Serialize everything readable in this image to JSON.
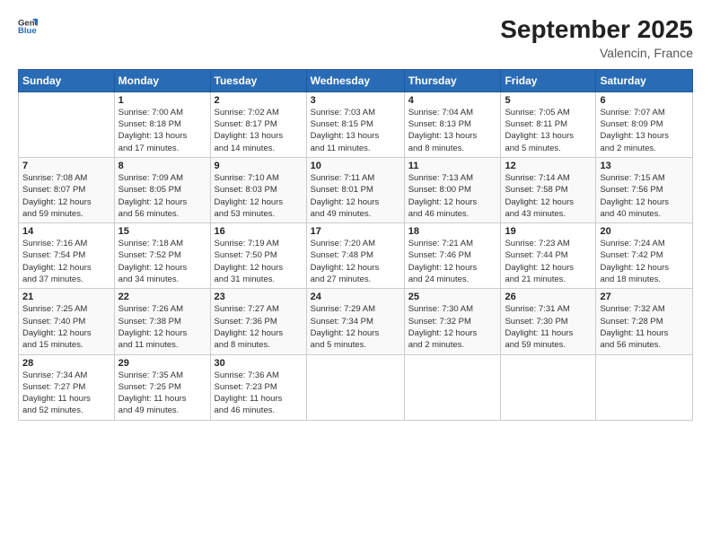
{
  "logo": {
    "general": "General",
    "blue": "Blue"
  },
  "title": "September 2025",
  "subtitle": "Valencin, France",
  "days_header": [
    "Sunday",
    "Monday",
    "Tuesday",
    "Wednesday",
    "Thursday",
    "Friday",
    "Saturday"
  ],
  "weeks": [
    [
      {
        "num": "",
        "info": ""
      },
      {
        "num": "1",
        "info": "Sunrise: 7:00 AM\nSunset: 8:18 PM\nDaylight: 13 hours\nand 17 minutes."
      },
      {
        "num": "2",
        "info": "Sunrise: 7:02 AM\nSunset: 8:17 PM\nDaylight: 13 hours\nand 14 minutes."
      },
      {
        "num": "3",
        "info": "Sunrise: 7:03 AM\nSunset: 8:15 PM\nDaylight: 13 hours\nand 11 minutes."
      },
      {
        "num": "4",
        "info": "Sunrise: 7:04 AM\nSunset: 8:13 PM\nDaylight: 13 hours\nand 8 minutes."
      },
      {
        "num": "5",
        "info": "Sunrise: 7:05 AM\nSunset: 8:11 PM\nDaylight: 13 hours\nand 5 minutes."
      },
      {
        "num": "6",
        "info": "Sunrise: 7:07 AM\nSunset: 8:09 PM\nDaylight: 13 hours\nand 2 minutes."
      }
    ],
    [
      {
        "num": "7",
        "info": "Sunrise: 7:08 AM\nSunset: 8:07 PM\nDaylight: 12 hours\nand 59 minutes."
      },
      {
        "num": "8",
        "info": "Sunrise: 7:09 AM\nSunset: 8:05 PM\nDaylight: 12 hours\nand 56 minutes."
      },
      {
        "num": "9",
        "info": "Sunrise: 7:10 AM\nSunset: 8:03 PM\nDaylight: 12 hours\nand 53 minutes."
      },
      {
        "num": "10",
        "info": "Sunrise: 7:11 AM\nSunset: 8:01 PM\nDaylight: 12 hours\nand 49 minutes."
      },
      {
        "num": "11",
        "info": "Sunrise: 7:13 AM\nSunset: 8:00 PM\nDaylight: 12 hours\nand 46 minutes."
      },
      {
        "num": "12",
        "info": "Sunrise: 7:14 AM\nSunset: 7:58 PM\nDaylight: 12 hours\nand 43 minutes."
      },
      {
        "num": "13",
        "info": "Sunrise: 7:15 AM\nSunset: 7:56 PM\nDaylight: 12 hours\nand 40 minutes."
      }
    ],
    [
      {
        "num": "14",
        "info": "Sunrise: 7:16 AM\nSunset: 7:54 PM\nDaylight: 12 hours\nand 37 minutes."
      },
      {
        "num": "15",
        "info": "Sunrise: 7:18 AM\nSunset: 7:52 PM\nDaylight: 12 hours\nand 34 minutes."
      },
      {
        "num": "16",
        "info": "Sunrise: 7:19 AM\nSunset: 7:50 PM\nDaylight: 12 hours\nand 31 minutes."
      },
      {
        "num": "17",
        "info": "Sunrise: 7:20 AM\nSunset: 7:48 PM\nDaylight: 12 hours\nand 27 minutes."
      },
      {
        "num": "18",
        "info": "Sunrise: 7:21 AM\nSunset: 7:46 PM\nDaylight: 12 hours\nand 24 minutes."
      },
      {
        "num": "19",
        "info": "Sunrise: 7:23 AM\nSunset: 7:44 PM\nDaylight: 12 hours\nand 21 minutes."
      },
      {
        "num": "20",
        "info": "Sunrise: 7:24 AM\nSunset: 7:42 PM\nDaylight: 12 hours\nand 18 minutes."
      }
    ],
    [
      {
        "num": "21",
        "info": "Sunrise: 7:25 AM\nSunset: 7:40 PM\nDaylight: 12 hours\nand 15 minutes."
      },
      {
        "num": "22",
        "info": "Sunrise: 7:26 AM\nSunset: 7:38 PM\nDaylight: 12 hours\nand 11 minutes."
      },
      {
        "num": "23",
        "info": "Sunrise: 7:27 AM\nSunset: 7:36 PM\nDaylight: 12 hours\nand 8 minutes."
      },
      {
        "num": "24",
        "info": "Sunrise: 7:29 AM\nSunset: 7:34 PM\nDaylight: 12 hours\nand 5 minutes."
      },
      {
        "num": "25",
        "info": "Sunrise: 7:30 AM\nSunset: 7:32 PM\nDaylight: 12 hours\nand 2 minutes."
      },
      {
        "num": "26",
        "info": "Sunrise: 7:31 AM\nSunset: 7:30 PM\nDaylight: 11 hours\nand 59 minutes."
      },
      {
        "num": "27",
        "info": "Sunrise: 7:32 AM\nSunset: 7:28 PM\nDaylight: 11 hours\nand 56 minutes."
      }
    ],
    [
      {
        "num": "28",
        "info": "Sunrise: 7:34 AM\nSunset: 7:27 PM\nDaylight: 11 hours\nand 52 minutes."
      },
      {
        "num": "29",
        "info": "Sunrise: 7:35 AM\nSunset: 7:25 PM\nDaylight: 11 hours\nand 49 minutes."
      },
      {
        "num": "30",
        "info": "Sunrise: 7:36 AM\nSunset: 7:23 PM\nDaylight: 11 hours\nand 46 minutes."
      },
      {
        "num": "",
        "info": ""
      },
      {
        "num": "",
        "info": ""
      },
      {
        "num": "",
        "info": ""
      },
      {
        "num": "",
        "info": ""
      }
    ]
  ]
}
